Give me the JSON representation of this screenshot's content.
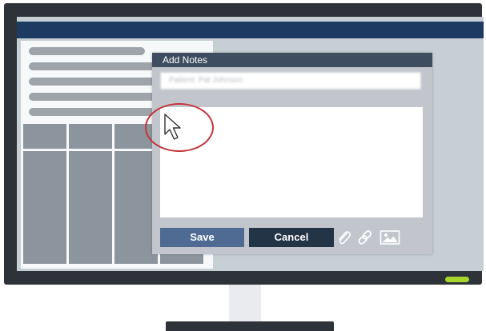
{
  "dialog": {
    "title": "Add Notes",
    "patient_field": "Patient: Pat Johnson",
    "notes_value": "",
    "save_label": "Save",
    "cancel_label": "Cancel",
    "toolbar_icons": [
      "paperclip-icon",
      "link-icon",
      "image-icon"
    ]
  },
  "colors": {
    "header_bar": "#1d3b62",
    "dialog_title_bar": "#3e4e60",
    "save_button": "#4f6b93",
    "cancel_button": "#243447",
    "highlight_circle": "#c4343a",
    "power_led": "#a6d62a"
  }
}
